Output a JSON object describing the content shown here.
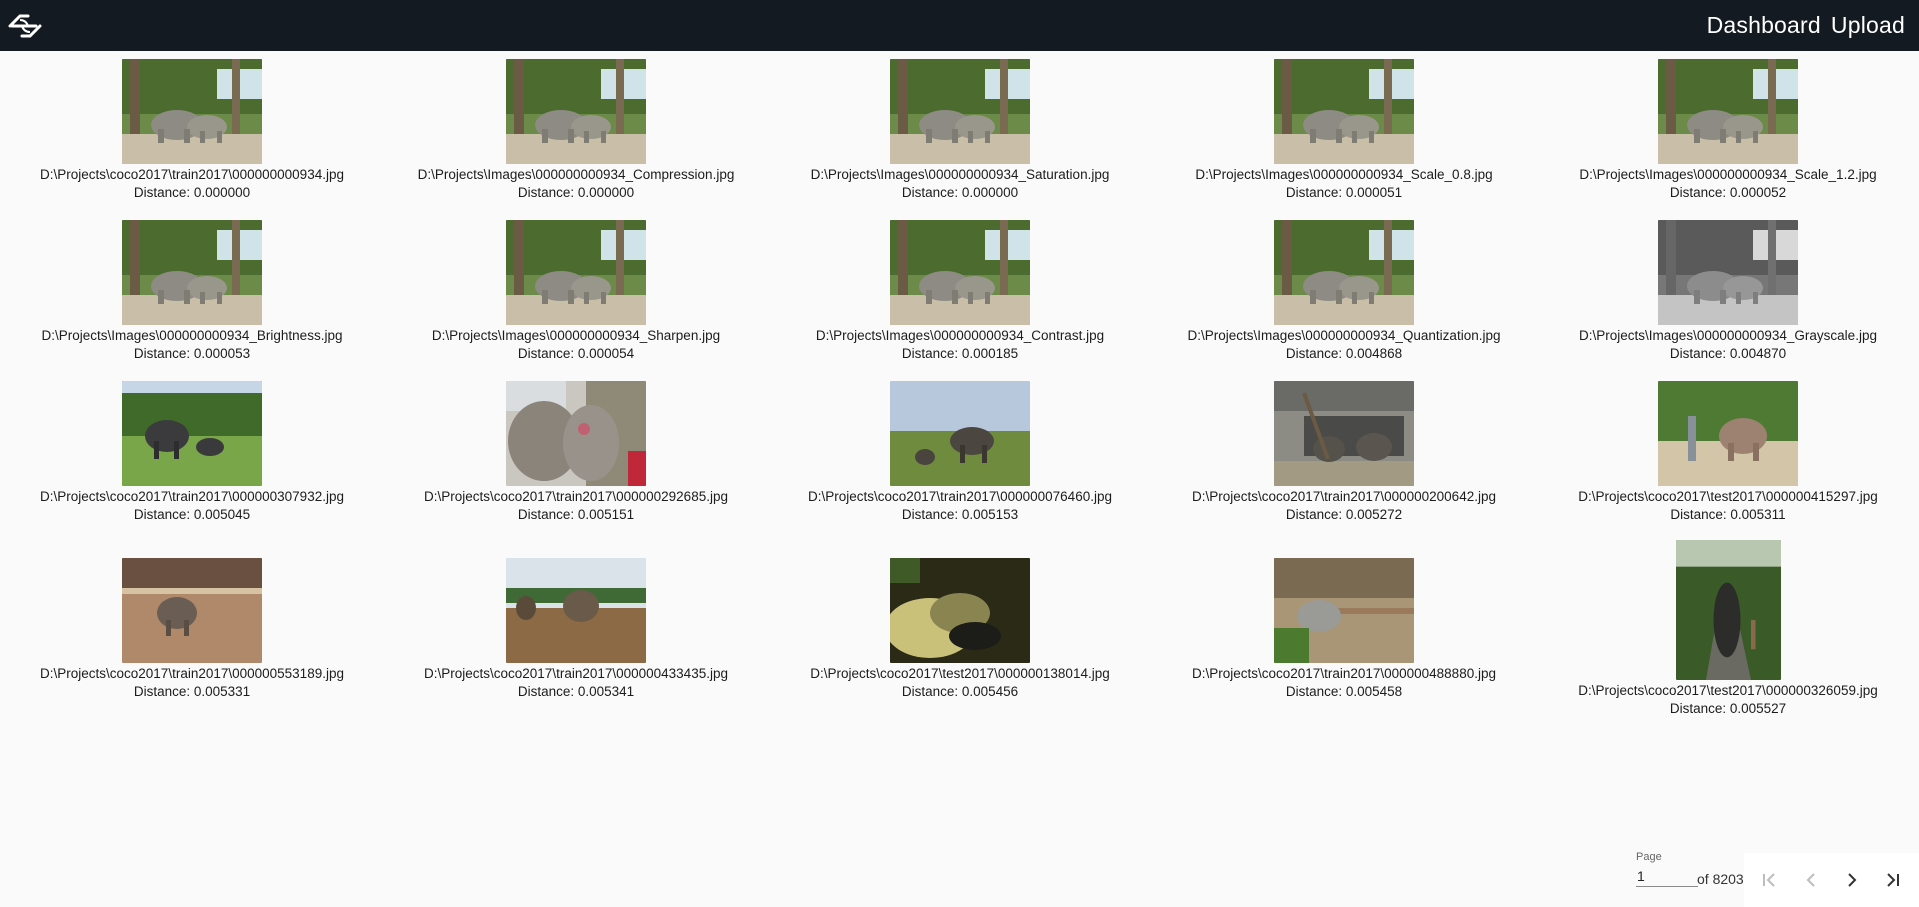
{
  "header": {
    "logo_icon": "logo-icon",
    "nav": [
      {
        "label": "Dashboard"
      },
      {
        "label": "Upload"
      }
    ]
  },
  "results": [
    {
      "file": "D:\\Projects\\coco2017\\train2017\\000000000934.jpg",
      "distance": "Distance: 0.000000",
      "image": "elephants-934"
    },
    {
      "file": "D:\\Projects\\Images\\000000000934_Compression.jpg",
      "distance": "Distance: 0.000000",
      "image": "elephants-934"
    },
    {
      "file": "D:\\Projects\\Images\\000000000934_Saturation.jpg",
      "distance": "Distance: 0.000000",
      "image": "elephants-934"
    },
    {
      "file": "D:\\Projects\\Images\\000000000934_Scale_0.8.jpg",
      "distance": "Distance: 0.000051",
      "image": "elephants-934"
    },
    {
      "file": "D:\\Projects\\Images\\000000000934_Scale_1.2.jpg",
      "distance": "Distance: 0.000052",
      "image": "elephants-934"
    },
    {
      "file": "D:\\Projects\\Images\\000000000934_Brightness.jpg",
      "distance": "Distance: 0.000053",
      "image": "elephants-934"
    },
    {
      "file": "D:\\Projects\\Images\\000000000934_Sharpen.jpg",
      "distance": "Distance: 0.000054",
      "image": "elephants-934"
    },
    {
      "file": "D:\\Projects\\Images\\000000000934_Contrast.jpg",
      "distance": "Distance: 0.000185",
      "image": "elephants-934"
    },
    {
      "file": "D:\\Projects\\Images\\000000000934_Quantization.jpg",
      "distance": "Distance: 0.004868",
      "image": "elephants-934"
    },
    {
      "file": "D:\\Projects\\Images\\000000000934_Grayscale.jpg",
      "distance": "Distance: 0.004870",
      "image": "elephants-934-gray"
    },
    {
      "file": "D:\\Projects\\coco2017\\train2017\\000000307932.jpg",
      "distance": "Distance: 0.005045",
      "image": "elephants-field"
    },
    {
      "file": "D:\\Projects\\coco2017\\train2017\\000000292685.jpg",
      "distance": "Distance: 0.005151",
      "image": "elephants-closeup"
    },
    {
      "file": "D:\\Projects\\coco2017\\train2017\\000000076460.jpg",
      "distance": "Distance: 0.005153",
      "image": "elephants-meadow"
    },
    {
      "file": "D:\\Projects\\coco2017\\train2017\\000000200642.jpg",
      "distance": "Distance: 0.005272",
      "image": "elephants-enclosure"
    },
    {
      "file": "D:\\Projects\\coco2017\\test2017\\000000415297.jpg",
      "distance": "Distance: 0.005311",
      "image": "elephant-forest"
    },
    {
      "file": "D:\\Projects\\coco2017\\train2017\\000000553189.jpg",
      "distance": "Distance: 0.005331",
      "image": "elephant-calf"
    },
    {
      "file": "D:\\Projects\\coco2017\\train2017\\000000433435.jpg",
      "distance": "Distance: 0.005341",
      "image": "elephants-dirt"
    },
    {
      "file": "D:\\Projects\\coco2017\\test2017\\000000138014.jpg",
      "distance": "Distance: 0.005456",
      "image": "elephant-water"
    },
    {
      "file": "D:\\Projects\\coco2017\\train2017\\000000488880.jpg",
      "distance": "Distance: 0.005458",
      "image": "elephant-rocks"
    },
    {
      "file": "D:\\Projects\\coco2017\\test2017\\000000326059.jpg",
      "distance": "Distance: 0.005527",
      "image": "elephant-path"
    }
  ],
  "pagination": {
    "label": "Page",
    "value": "1",
    "of_text": "of 8203",
    "buttons": [
      {
        "icon": "first-page-icon"
      },
      {
        "icon": "previous-page-icon"
      },
      {
        "icon": "next-page-icon"
      },
      {
        "icon": "last-page-icon"
      }
    ]
  }
}
